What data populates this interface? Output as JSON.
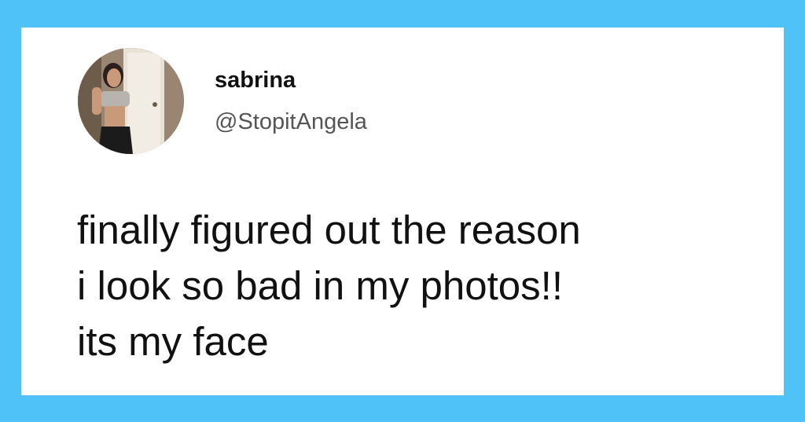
{
  "tweet": {
    "display_name": "sabrina",
    "handle": "@StopitAngela",
    "text_lines": [
      "finally figured out the reason",
      "i look so bad in my photos!!",
      "its my face"
    ]
  },
  "colors": {
    "frame_background": "#4fc3f7",
    "card_background": "#ffffff",
    "text_primary": "#111111",
    "text_secondary": "#555555"
  },
  "icons": {
    "avatar": "profile-photo-avatar"
  }
}
